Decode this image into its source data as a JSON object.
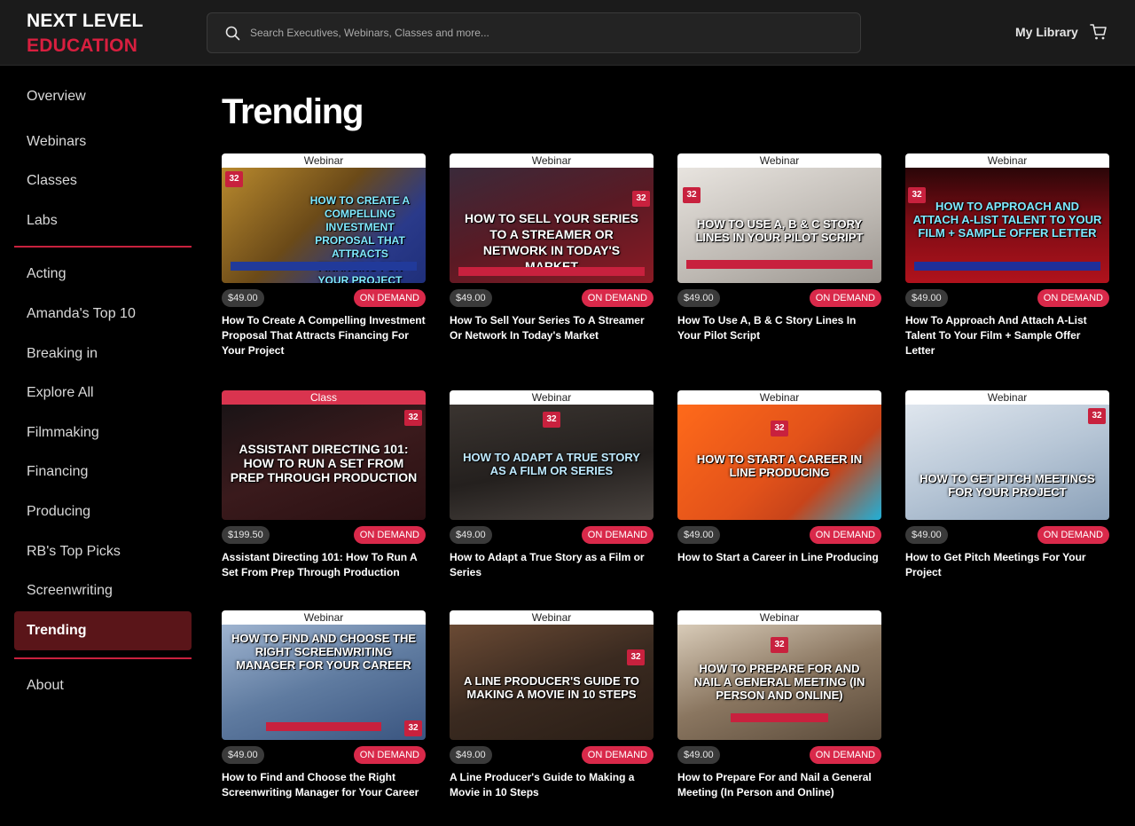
{
  "brand": {
    "line1": "NEXT LEVEL",
    "line2": "EDUCATION"
  },
  "search": {
    "placeholder": "Search Executives, Webinars, Classes and more..."
  },
  "header": {
    "my_library": "My Library"
  },
  "sidebar": {
    "group1": [
      "Overview",
      "Webinars",
      "Classes",
      "Labs"
    ],
    "group2": [
      "Acting",
      "Amanda's Top 10",
      "Breaking in",
      "Explore All",
      "Filmmaking",
      "Financing",
      "Producing",
      "RB's Top Picks",
      "Screenwriting",
      "Trending"
    ],
    "group3": [
      "About"
    ],
    "active": "Trending"
  },
  "main": {
    "title": "Trending",
    "cards": [
      {
        "type": "Webinar",
        "thumb_text": "How to create a compelling investment proposal that attracts financing for your project",
        "price": "$49.00",
        "badge": "ON DEMAND",
        "title": "How To Create A Compelling Investment Proposal That Attracts Financing For Your Project"
      },
      {
        "type": "Webinar",
        "thumb_text": "How to sell your series to a streamer or network in today's market",
        "price": "$49.00",
        "badge": "ON DEMAND",
        "title": "How To Sell Your Series To A Streamer Or Network In Today's Market"
      },
      {
        "type": "Webinar",
        "thumb_text": "How to use A, B & C story lines in your pilot script",
        "price": "$49.00",
        "badge": "ON DEMAND",
        "title": "How To Use A, B & C Story Lines In Your Pilot Script"
      },
      {
        "type": "Webinar",
        "thumb_text": "How to approach and attach A-list talent to your film + sample offer letter",
        "price": "$49.00",
        "badge": "ON DEMAND",
        "title": "How To Approach And Attach A-List Talent To Your Film + Sample Offer Letter"
      },
      {
        "type": "Class",
        "thumb_text": "Assistant Directing 101: How to run a set from prep through production",
        "price": "$199.50",
        "badge": "ON DEMAND",
        "title": "Assistant Directing 101: How To Run A Set From Prep Through Production"
      },
      {
        "type": "Webinar",
        "thumb_text": "How to adapt a true story as a film or series",
        "price": "$49.00",
        "badge": "ON DEMAND",
        "title": "How to Adapt a True Story as a Film or Series"
      },
      {
        "type": "Webinar",
        "thumb_text": "How to start a career in line producing",
        "price": "$49.00",
        "badge": "ON DEMAND",
        "title": "How to Start a Career in Line Producing"
      },
      {
        "type": "Webinar",
        "thumb_text": "How to get pitch meetings for your project",
        "price": "$49.00",
        "badge": "ON DEMAND",
        "title": "How to Get Pitch Meetings For Your Project"
      },
      {
        "type": "Webinar",
        "thumb_text": "How to find and choose the right screenwriting manager for your career",
        "price": "$49.00",
        "badge": "ON DEMAND",
        "title": "How to Find and Choose the Right Screenwriting Manager for Your Career"
      },
      {
        "type": "Webinar",
        "thumb_text": "A line producer's guide to making a movie in 10 steps",
        "price": "$49.00",
        "badge": "ON DEMAND",
        "title": "A Line Producer's Guide to Making a Movie in 10 Steps"
      },
      {
        "type": "Webinar",
        "thumb_text": "How to prepare for and nail a general meeting (in person and online)",
        "price": "$49.00",
        "badge": "ON DEMAND",
        "title": "How to Prepare For and Nail a General Meeting (In Person and Online)"
      }
    ]
  },
  "colors": {
    "accent": "#d81f3f",
    "active_nav": "#5a1519",
    "header_bg": "#1b1b1b"
  },
  "icons": {
    "search": "search-icon",
    "cart": "cart-icon"
  }
}
